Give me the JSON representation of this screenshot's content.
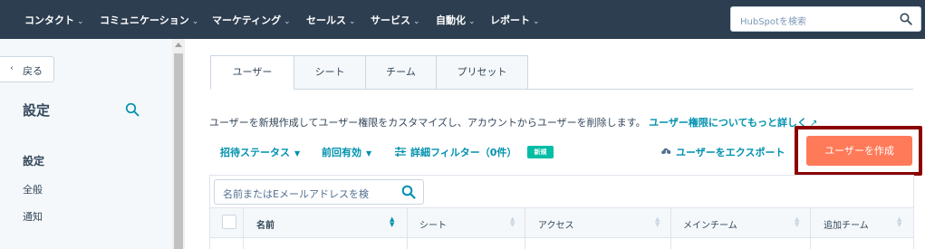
{
  "topnav": {
    "items": [
      "コンタクト",
      "コミュニケーション",
      "マーケティング",
      "セールス",
      "サービス",
      "自動化",
      "レポート"
    ],
    "search_placeholder": "HubSpotを検索"
  },
  "sidebar": {
    "back_label": "戻る",
    "title": "設定",
    "section": "設定",
    "items": [
      "全般",
      "通知"
    ]
  },
  "tabs": [
    "ユーザー",
    "シート",
    "チーム",
    "プリセット"
  ],
  "description": {
    "text": "ユーザーを新規作成してユーザー権限をカスタマイズし、アカウントからユーザーを削除します。",
    "link": "ユーザー権限についてもっと詳しく"
  },
  "filters": {
    "invite_status": "招待ステータス",
    "last_active": "前回有効",
    "advanced": "詳細フィルター（0件）",
    "new_badge": "新規"
  },
  "export_label": "ユーザーをエクスポート",
  "create_label": "ユーザーを作成",
  "table": {
    "search_placeholder": "名前またはEメールアドレスを検",
    "columns": [
      "名前",
      "シート",
      "アクセス",
      "メインチーム",
      "追加チーム"
    ]
  },
  "colors": {
    "nav_bg": "#2d3e50",
    "link": "#0091ae",
    "primary_button": "#ff7a59",
    "highlight_frame": "#8b0000",
    "badge": "#00bda5"
  }
}
